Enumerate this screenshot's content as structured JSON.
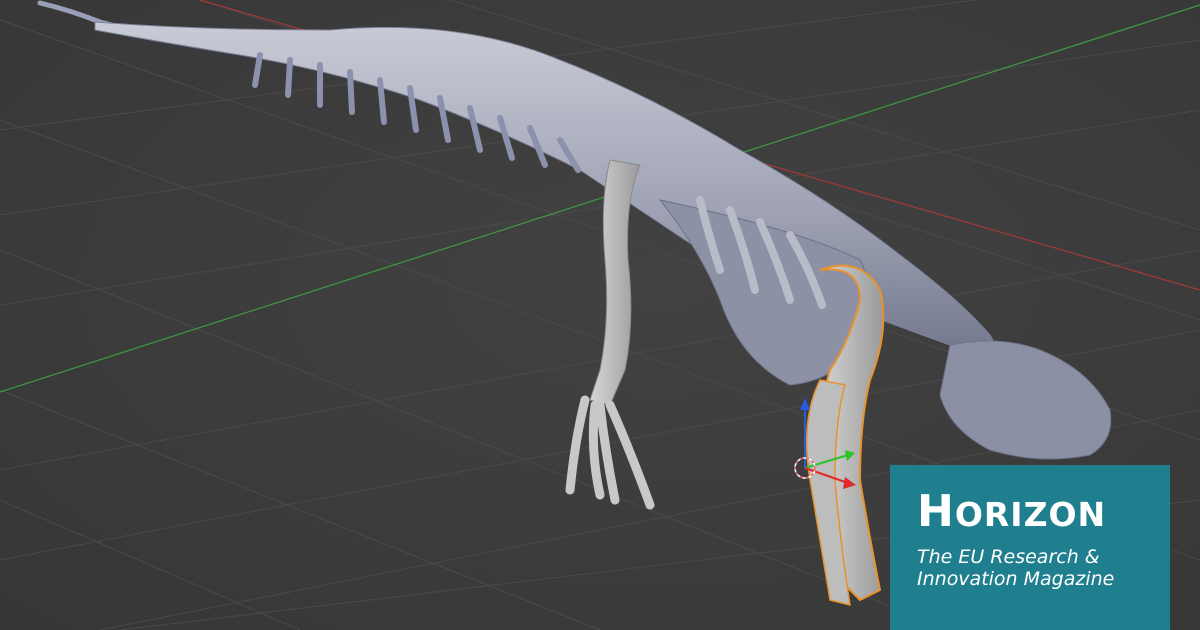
{
  "viewport": {
    "subject": "dinosaur skeleton 3D scan",
    "background_color": "#3d3d3d",
    "grid_color": "#4a4a4a",
    "x_axis_color": "#a23a3a",
    "y_axis_color": "#3f9a3f",
    "selection_outline_color": "#e8922e",
    "gizmo_colors": {
      "x": "#e02a2a",
      "y": "#2ac32a",
      "z": "#2a5ae0"
    }
  },
  "brand": {
    "title_initial": "H",
    "title_rest": "ORIZON",
    "subtitle_line1": "The EU Research &",
    "subtitle_line2": "Innovation Magazine",
    "panel_color": "#1f7f8f"
  }
}
